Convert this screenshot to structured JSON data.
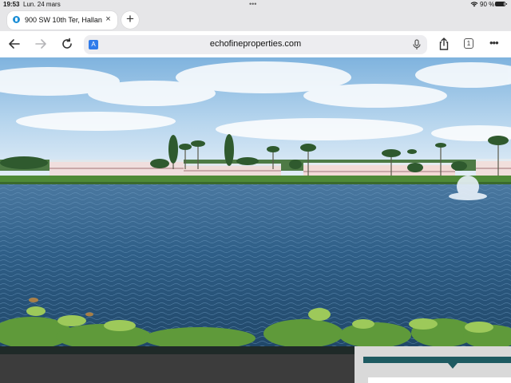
{
  "status_bar": {
    "time": "19:53",
    "date": "Lun. 24 mars",
    "battery_text": "90 %",
    "battery_level": 0.9,
    "icons": [
      "wifi-icon",
      "battery-icon"
    ]
  },
  "tabs": {
    "active_title": "900 SW 10th Ter, Hallan",
    "close_glyph": "×",
    "new_tab_glyph": "+"
  },
  "toolbar": {
    "url": "echofineproperties.com",
    "tabs_count": "1",
    "more_glyph": "•••",
    "translate_glyph": "A"
  },
  "colors": {
    "accent": "#2f7bea",
    "teal": "#1e5a61",
    "water": "#2e5f86",
    "sky": "#9cc6e6"
  }
}
